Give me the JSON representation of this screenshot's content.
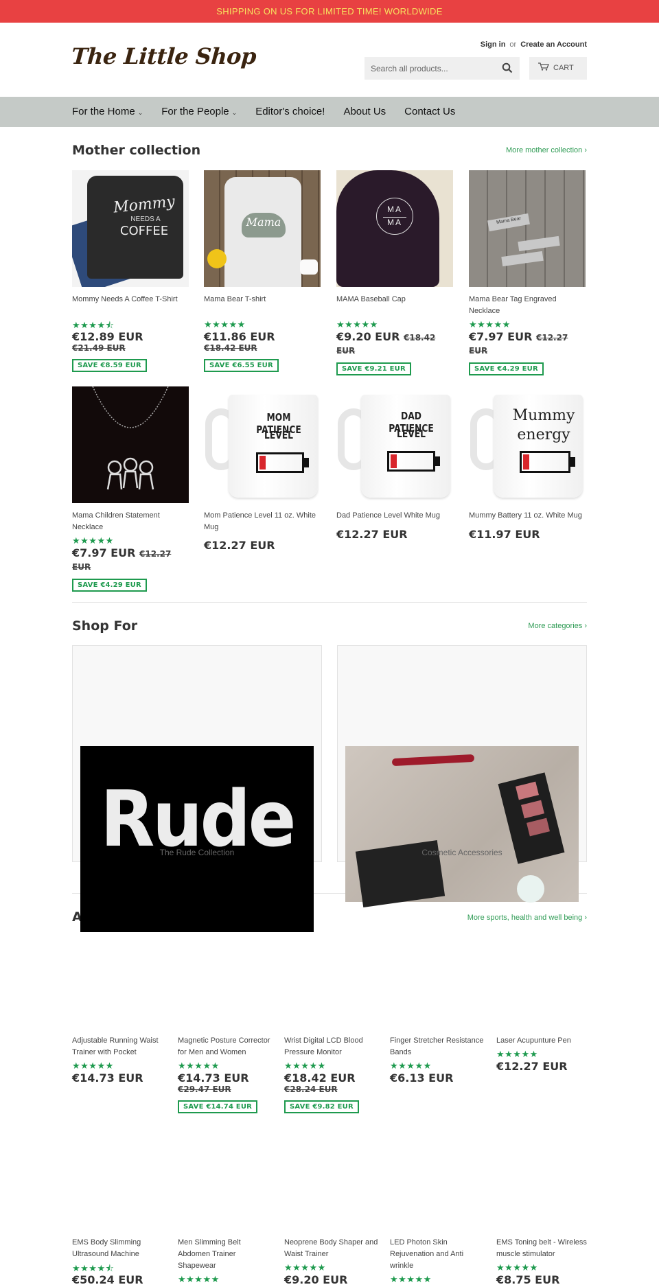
{
  "announcement": "SHIPPING ON US FOR LIMITED TIME! WORLDWIDE",
  "header": {
    "logo": "The Little Shop",
    "sign_in": "Sign in",
    "or": "or",
    "create_account": "Create an Account",
    "search_placeholder": "Search all products...",
    "search_icon": "search-icon",
    "cart_label": "CART",
    "cart_icon": "cart-icon"
  },
  "nav": {
    "items": [
      {
        "label": "For the Home",
        "dropdown": true
      },
      {
        "label": "For the People",
        "dropdown": true
      },
      {
        "label": "Editor's choice!",
        "dropdown": false
      },
      {
        "label": "About Us",
        "dropdown": false
      },
      {
        "label": "Contact Us",
        "dropdown": false
      }
    ]
  },
  "mother": {
    "title": "Mother collection",
    "more": "More mother collection ›",
    "products": [
      {
        "name": "Mommy Needs A Coffee T-Shirt",
        "stars": "★★★★⯪",
        "price": "€12.89 EUR",
        "compare": "€21.49 EUR",
        "save": "SAVE €8.59 EUR"
      },
      {
        "name": "Mama Bear T-shirt",
        "stars": "★★★★★",
        "price": "€11.86 EUR",
        "compare": "€18.42 EUR",
        "save": "SAVE €6.55 EUR"
      },
      {
        "name": "MAMA Baseball Cap",
        "stars": "★★★★★",
        "price": "€9.20 EUR",
        "compare": "€18.42 EUR",
        "save": "SAVE €9.21 EUR"
      },
      {
        "name": "Mama Bear Tag Engraved Necklace",
        "stars": "★★★★★",
        "price": "€7.97 EUR",
        "compare": "€12.27 EUR",
        "save": "SAVE €4.29 EUR"
      },
      {
        "name": "Mama Children Statement Necklace",
        "stars": "★★★★★",
        "price": "€7.97 EUR",
        "compare": "€12.27 EUR",
        "save": "SAVE €4.29 EUR"
      },
      {
        "name": "Mom Patience Level 11 oz. White Mug",
        "stars": "",
        "price": "€12.27 EUR",
        "compare": "",
        "save": ""
      },
      {
        "name": "Dad Patience Level White Mug",
        "stars": "",
        "price": "€12.27 EUR",
        "compare": "",
        "save": ""
      },
      {
        "name": "Mummy Battery 11 oz. White Mug",
        "stars": "",
        "price": "€11.97 EUR",
        "compare": "",
        "save": ""
      }
    ],
    "image_text": {
      "coffee_1": "Mommy",
      "coffee_2": "NEEDS A",
      "coffee_3": "COFFEE",
      "bear": "Mama",
      "cap_1": "MA",
      "cap_2": "MA",
      "tag": "Mama Bear",
      "mom_mug_1": "MOM PATIENCE",
      "mom_mug_2": "LEVEL",
      "dad_mug_1": "DAD PATIENCE",
      "dad_mug_2": "LEVEL",
      "mummy_mug_1": "Mummy",
      "mummy_mug_2": "energy"
    }
  },
  "shop_for": {
    "title": "Shop For",
    "more": "More categories ›",
    "categories": [
      {
        "label": "The Rude Collection",
        "image_text": "Rude"
      },
      {
        "label": "Cosmetic Accessories"
      }
    ]
  },
  "sports": {
    "title_initial": "A",
    "more": "More sports, health and well being ›",
    "products": [
      {
        "name": "Adjustable Running Waist Trainer with Pocket",
        "stars": "★★★★★",
        "price": "€14.73 EUR",
        "compare": "",
        "save": ""
      },
      {
        "name": "Magnetic Posture Corrector for Men and Women",
        "stars": "★★★★★",
        "price": "€14.73 EUR",
        "compare": "€29.47 EUR",
        "save": "SAVE €14.74 EUR"
      },
      {
        "name": "Wrist Digital LCD Blood Pressure Monitor",
        "stars": "★★★★★",
        "price": "€18.42 EUR",
        "compare": "€28.24 EUR",
        "save": "SAVE €9.82 EUR"
      },
      {
        "name": "Finger Stretcher Resistance Bands",
        "stars": "★★★★★",
        "price": "€6.13 EUR",
        "compare": "",
        "save": ""
      },
      {
        "name": "Laser Acupunture Pen",
        "stars": "★★★★★",
        "price": "€12.27 EUR",
        "compare": "",
        "save": ""
      },
      {
        "name": "EMS Body Slimming Ultrasound Machine",
        "stars": "★★★★⯪",
        "price": "€50.24 EUR",
        "compare": "",
        "save": ""
      },
      {
        "name": "Men Slimming Belt Abdomen Trainer Shapewear",
        "stars": "★★★★★",
        "price": "",
        "compare": "",
        "save": ""
      },
      {
        "name": "Neoprene Body Shaper and Waist Trainer",
        "stars": "★★★★★",
        "price": "€9.20 EUR",
        "compare": "",
        "save": ""
      },
      {
        "name": "LED Photon Skin Rejuvenation and Anti wrinkle",
        "stars": "★★★★★",
        "price": "",
        "compare": "",
        "save": ""
      },
      {
        "name": "EMS Toning belt - Wireless muscle stimulator",
        "stars": "★★★★★",
        "price": "€8.75 EUR",
        "compare": "",
        "save": ""
      }
    ]
  },
  "colors": {
    "announcement_bg": "#e84142",
    "announcement_text": "#f7e35f",
    "nav_bg": "#c5cac7",
    "accent_green": "#1e9a4e"
  }
}
